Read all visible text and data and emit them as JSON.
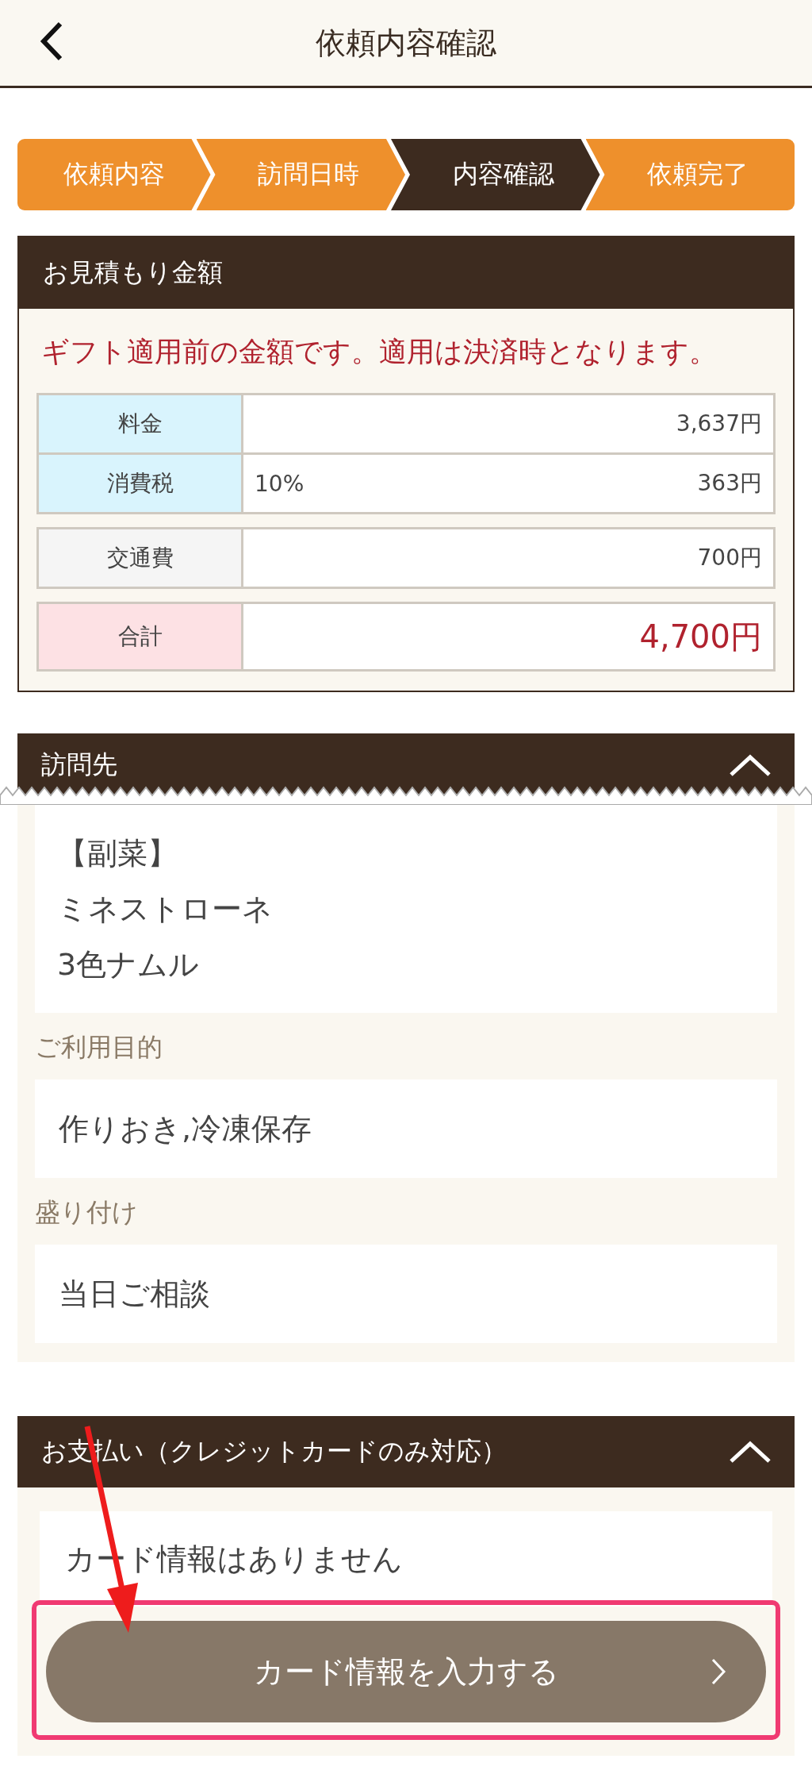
{
  "header": {
    "title": "依頼内容確認"
  },
  "steps": [
    {
      "label": "依頼内容",
      "selected": false
    },
    {
      "label": "訪問日時",
      "selected": false
    },
    {
      "label": "内容確認",
      "selected": true
    },
    {
      "label": "依頼完了",
      "selected": false
    }
  ],
  "estimate": {
    "title": "お見積もり金額",
    "notice": "ギフト適用前の金額です。適用は決済時となります。",
    "groups": [
      {
        "kind": "price",
        "rows": [
          {
            "label": "料金",
            "value": "3,637円"
          },
          {
            "label": "消費税",
            "note": "10%",
            "value": "363円"
          }
        ]
      },
      {
        "kind": "fee",
        "rows": [
          {
            "label": "交通費",
            "value": "700円"
          }
        ]
      },
      {
        "kind": "total",
        "rows": [
          {
            "label": "合計",
            "value": "4,700円"
          }
        ]
      }
    ]
  },
  "visit": {
    "title": "訪問先",
    "expanded": true,
    "menu_lines": [
      "【副菜】",
      "ミネストローネ",
      "3色ナムル"
    ],
    "fields": [
      {
        "label": "ご利用目的",
        "value": "作りおき,冷凍保存"
      },
      {
        "label": "盛り付け",
        "value": "当日ご相談"
      }
    ]
  },
  "payment": {
    "title": "お支払い（クレジットカードのみ対応）",
    "expanded": true,
    "message": "カード情報はありません",
    "button": "カード情報を入力する"
  },
  "annotations": {
    "arrow": true,
    "highlight": true
  }
}
